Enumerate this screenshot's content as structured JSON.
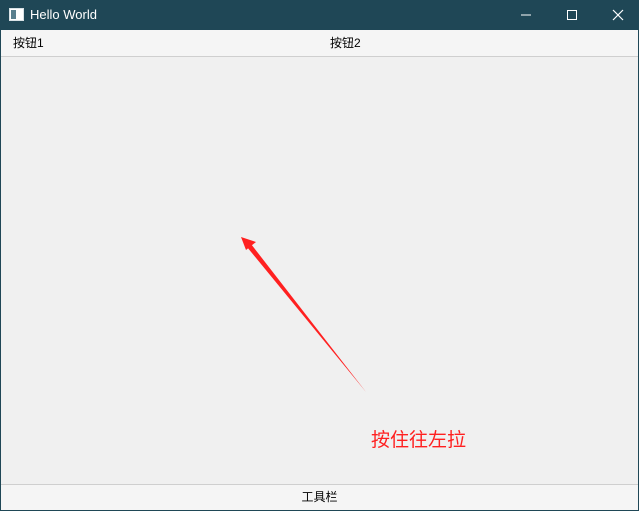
{
  "window": {
    "title": "Hello World",
    "app_icon": "window-app-icon",
    "controls": [
      "minimize-icon",
      "maximize-icon",
      "close-icon"
    ],
    "titlebar_color": "#1f4756"
  },
  "menubar": {
    "button1_label": "按钮1",
    "button2_label": "按钮2"
  },
  "canvas": {
    "hint_text": "按住往左拉",
    "annotation_color": "#ff2020",
    "arrow_icon": "arrow-up-left-icon"
  },
  "toolbar": {
    "label": "工具栏"
  }
}
